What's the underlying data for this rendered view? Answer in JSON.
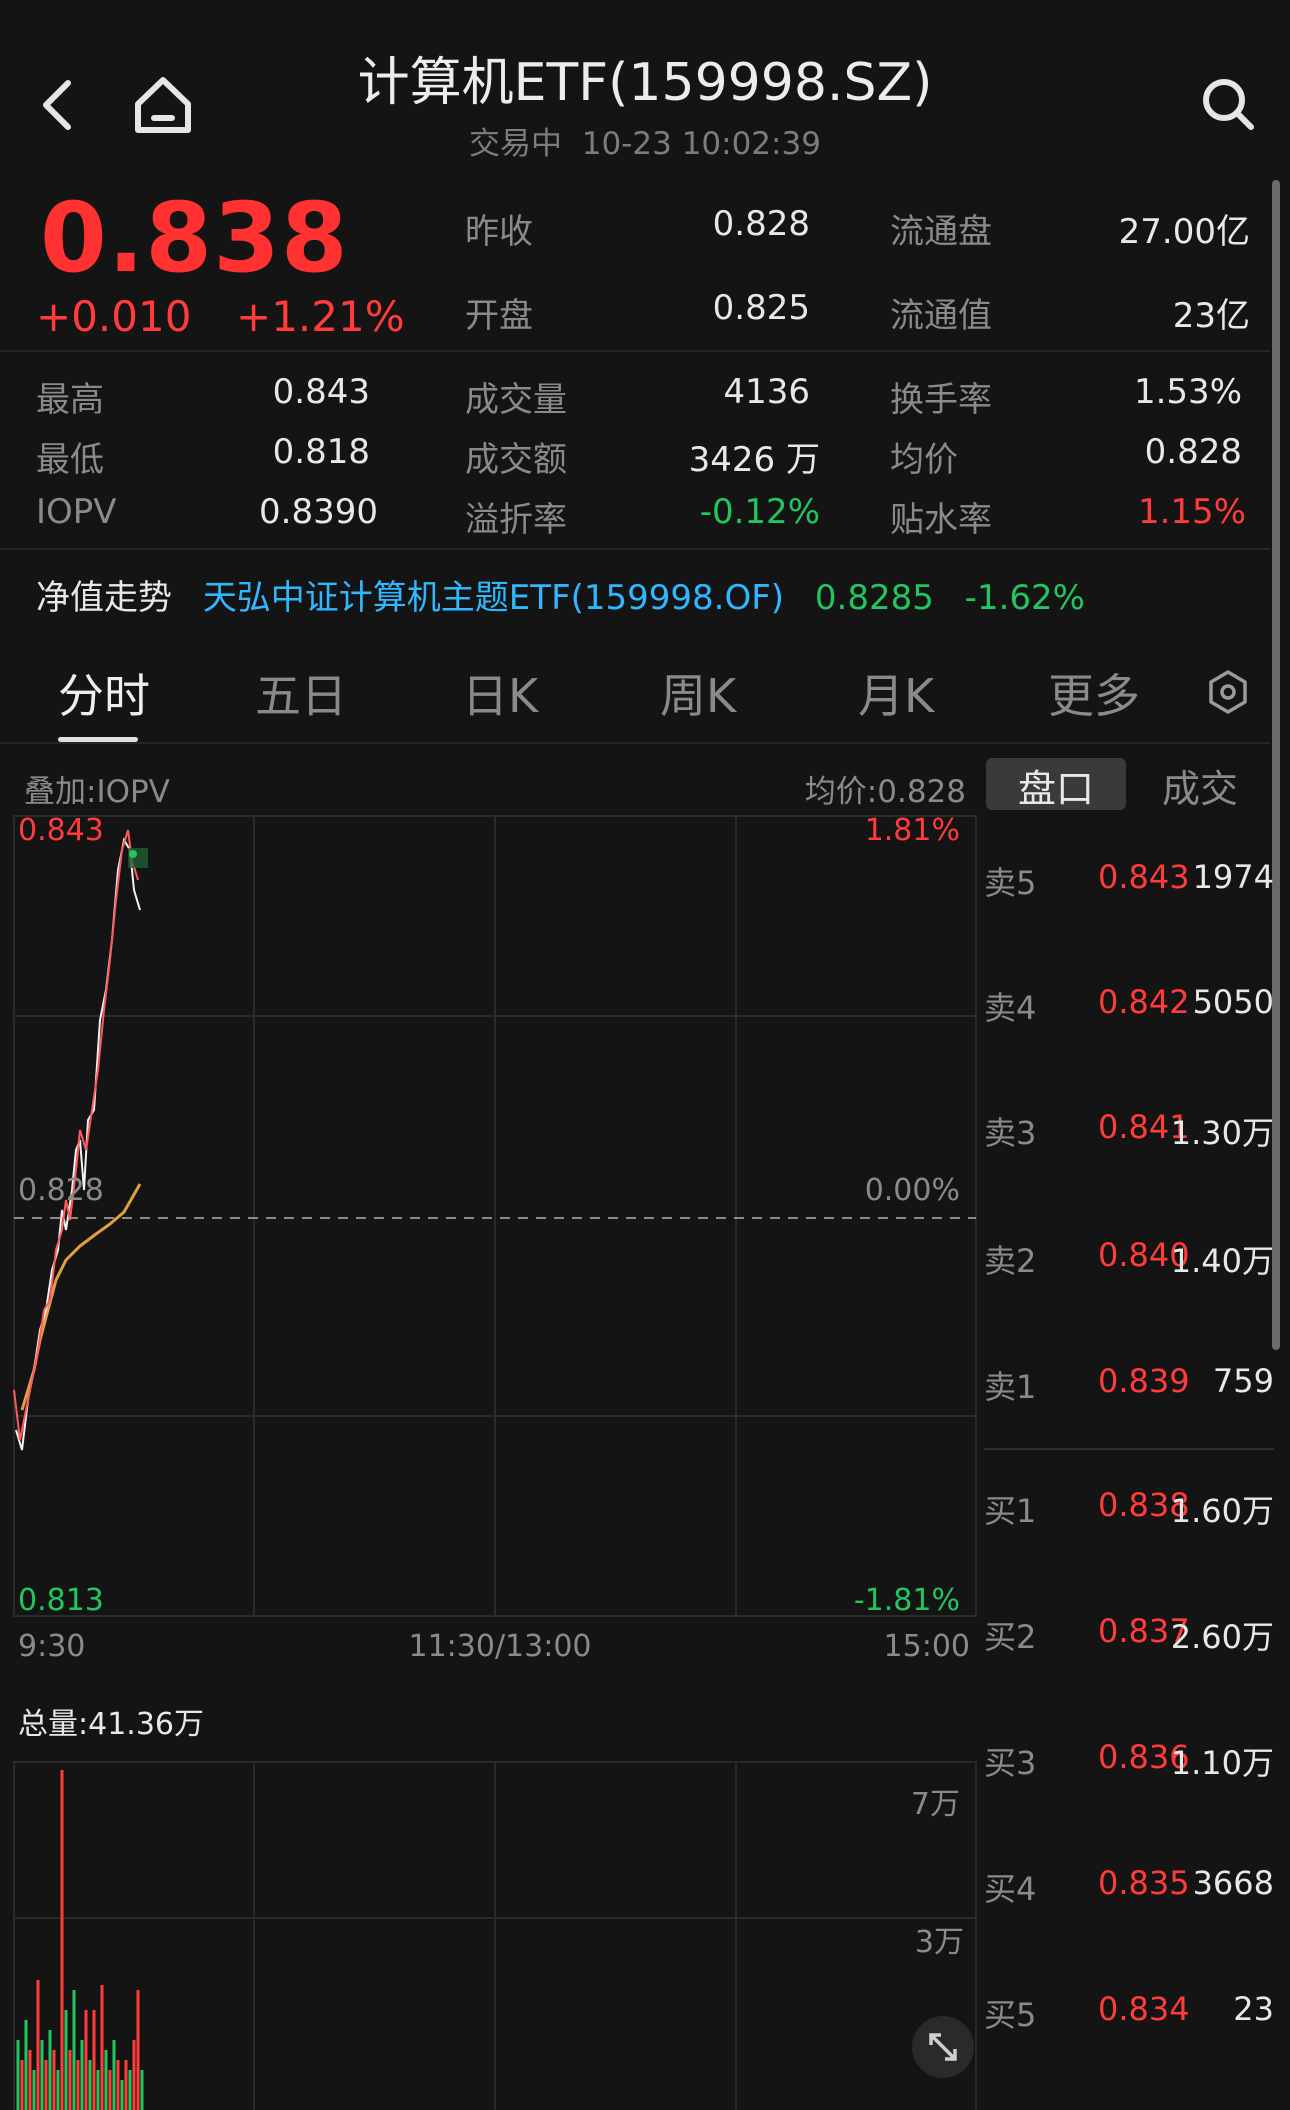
{
  "header": {
    "title": "计算机ETF(159998.SZ)",
    "status": "交易中",
    "datetime": "10-23 10:02:39"
  },
  "quote": {
    "price": "0.838",
    "change": "+0.010",
    "change_pct": "+1.21%",
    "stats_top": [
      {
        "label": "昨收",
        "value": "0.828"
      },
      {
        "label": "开盘",
        "value": "0.825"
      },
      {
        "label": "流通盘",
        "value": "27.00亿"
      },
      {
        "label": "流通值",
        "value": "23亿"
      }
    ],
    "stats_grid": [
      {
        "label": "最高",
        "value": "0.843",
        "color": "white"
      },
      {
        "label": "成交量",
        "value": "4136",
        "color": "white"
      },
      {
        "label": "换手率",
        "value": "1.53%",
        "color": "white"
      },
      {
        "label": "最低",
        "value": "0.818",
        "color": "white"
      },
      {
        "label": "成交额",
        "value": "3426 万",
        "color": "white"
      },
      {
        "label": "均价",
        "value": "0.828",
        "color": "white"
      },
      {
        "label": "IOPV",
        "value": "0.8390",
        "color": "white"
      },
      {
        "label": "溢折率",
        "value": "-0.12%",
        "color": "green"
      },
      {
        "label": "贴水率",
        "value": "1.15%",
        "color": "red"
      }
    ]
  },
  "nav": {
    "label": "净值走势",
    "fund": "天弘中证计算机主题ETF(159998.OF)",
    "value": "0.8285",
    "change": "-1.62%"
  },
  "tabs": [
    "分时",
    "五日",
    "日K",
    "周K",
    "月K",
    "更多"
  ],
  "chart": {
    "overlay": "叠加:IOPV",
    "avg_label": "均价:0.828",
    "y_high": "0.843",
    "y_mid": "0.828",
    "y_low": "0.813",
    "pct_high": "1.81%",
    "pct_mid": "0.00%",
    "pct_low": "-1.81%",
    "time_start": "9:30",
    "time_mid": "11:30/13:00",
    "time_end": "15:00",
    "vol_total": "总量:41.36万",
    "vol_tick_high": "7万",
    "vol_tick_low": "3万"
  },
  "side_tabs": [
    "盘口",
    "成交"
  ],
  "orderbook": {
    "asks": [
      {
        "label": "卖5",
        "price": "0.843",
        "vol": "1974"
      },
      {
        "label": "卖4",
        "price": "0.842",
        "vol": "5050"
      },
      {
        "label": "卖3",
        "price": "0.841",
        "vol": "1.30万"
      },
      {
        "label": "卖2",
        "price": "0.840",
        "vol": "1.40万"
      },
      {
        "label": "卖1",
        "price": "0.839",
        "vol": "759"
      }
    ],
    "bids": [
      {
        "label": "买1",
        "price": "0.838",
        "vol": "1.60万"
      },
      {
        "label": "买2",
        "price": "0.837",
        "vol": "2.60万"
      },
      {
        "label": "买3",
        "price": "0.836",
        "vol": "1.10万"
      },
      {
        "label": "买4",
        "price": "0.835",
        "vol": "3668"
      },
      {
        "label": "买5",
        "price": "0.834",
        "vol": "23"
      }
    ]
  },
  "colors": {
    "up": "#ff3b3b",
    "down": "#22c55e",
    "avg_line": "#e0a040",
    "accent": "#2fb7ff"
  },
  "icons": [
    "back-icon",
    "home-icon",
    "search-icon",
    "settings-hex-icon",
    "expand-icon"
  ]
}
